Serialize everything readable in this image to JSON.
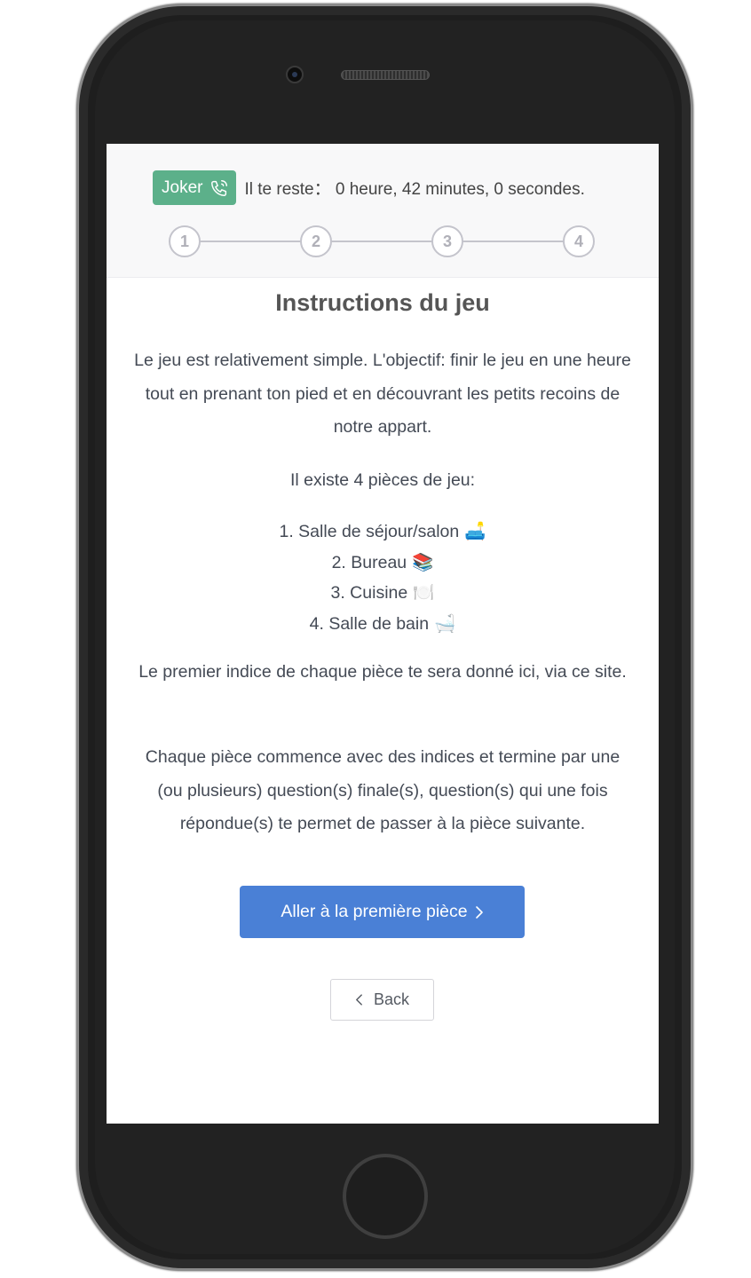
{
  "header": {
    "joker_label": "Joker",
    "joker_icon": "phone-ringing-icon",
    "timer_text": "Il te reste： 0 heure, 42 minutes, 0 secondes."
  },
  "steps": [
    "1",
    "2",
    "3",
    "4"
  ],
  "main": {
    "title": "Instructions du jeu",
    "intro": "Le jeu est relativement simple. L'objectif: finir le jeu en une heure tout en prenant ton pied et en découvrant les petits recoins de notre appart.",
    "rooms_intro": "Il existe 4 pièces de jeu:",
    "rooms": [
      {
        "label": "1. Salle de séjour/salon",
        "emoji": "🛋️",
        "icon": "couch-icon"
      },
      {
        "label": "2. Bureau",
        "emoji": "📚",
        "icon": "books-icon"
      },
      {
        "label": "3. Cuisine",
        "emoji": "🍽️",
        "icon": "plate-icon"
      },
      {
        "label": "4. Salle de bain",
        "emoji": "🛁",
        "icon": "bathtub-icon"
      }
    ],
    "first_clue": "Le premier indice de chaque pièce te sera donné ici, via ce site.",
    "rules": "Chaque pièce commence avec des indices et termine par une (ou plusieurs) question(s) finale(s), question(s) qui une fois répondue(s) te permet de passer à la pièce suivante."
  },
  "actions": {
    "primary_label": "Aller à la première pièce",
    "back_label": "Back"
  },
  "colors": {
    "joker_badge": "#5cb08a",
    "primary_button": "#4a80d6",
    "step_border": "#c4c4cc"
  }
}
